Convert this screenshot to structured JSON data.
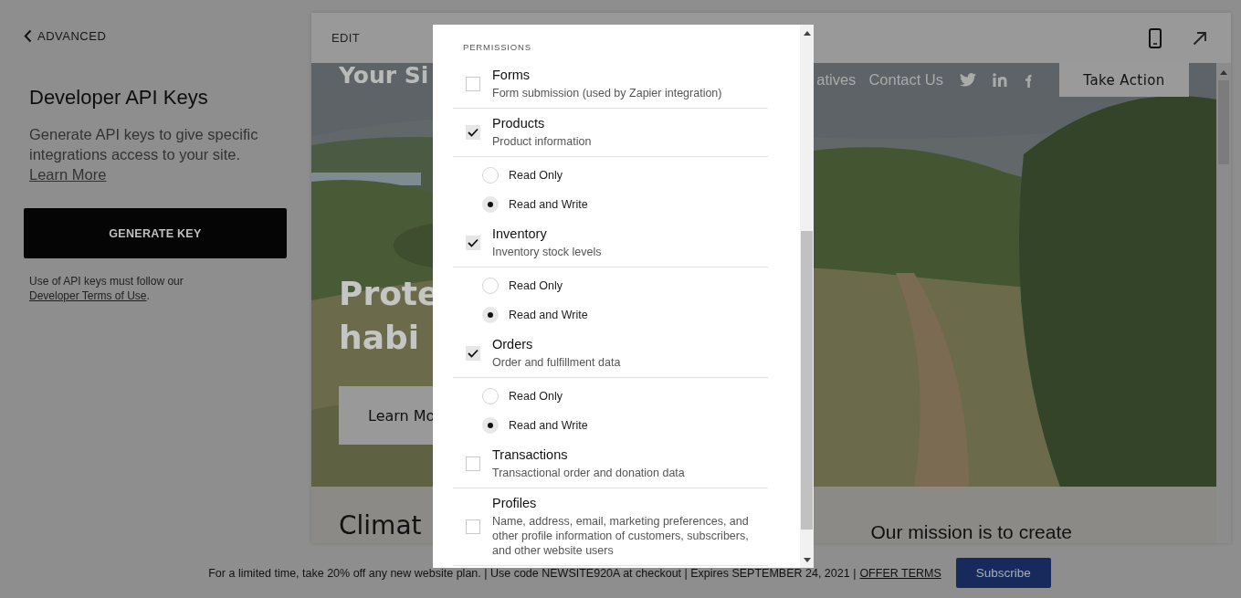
{
  "back_link": {
    "label": "ADVANCED"
  },
  "panel": {
    "title": "Developer API Keys",
    "description": "Generate API keys to give specific integrations access to your site.",
    "learn_more": "Learn More",
    "button": "GENERATE KEY",
    "note": "Use of API keys must follow our",
    "note_link": "Developer Terms of Use",
    "note_end": "."
  },
  "preview": {
    "edit": "EDIT",
    "logo": "Your Si",
    "nav": [
      "atives",
      "Contact Us"
    ],
    "cta": "Take Action",
    "hero_lines": [
      "Prote",
      "habi"
    ],
    "hero_button": "Learn Mo",
    "section_heading": "Climat",
    "mission": "Our mission is to create"
  },
  "dialog": {
    "heading": "PERMISSIONS",
    "permissions": [
      {
        "label": "Forms",
        "description": "Form submission (used by Zapier integration)",
        "checked": false
      },
      {
        "label": "Products",
        "description": "Product information",
        "checked": true,
        "options": [
          {
            "label": "Read Only",
            "selected": false
          },
          {
            "label": "Read and Write",
            "selected": true
          }
        ]
      },
      {
        "label": "Inventory",
        "description": "Inventory stock levels",
        "checked": true,
        "options": [
          {
            "label": "Read Only",
            "selected": false
          },
          {
            "label": "Read and Write",
            "selected": true
          }
        ]
      },
      {
        "label": "Orders",
        "description": "Order and fulfillment data",
        "checked": true,
        "options": [
          {
            "label": "Read Only",
            "selected": false
          },
          {
            "label": "Read and Write",
            "selected": true
          }
        ]
      },
      {
        "label": "Transactions",
        "description": "Transactional order and donation data",
        "checked": false
      },
      {
        "label": "Profiles",
        "description": "Name, address, email, marketing preferences, and other profile information of customers, subscribers, and other website users",
        "checked": false
      }
    ]
  },
  "banner": {
    "text": "For a limited time, take 20% off any new website plan. | Use code NEWSITE920A at checkout | Expires SEPTEMBER 24, 2021 |",
    "link": "OFFER TERMS",
    "button": "Subscribe"
  }
}
